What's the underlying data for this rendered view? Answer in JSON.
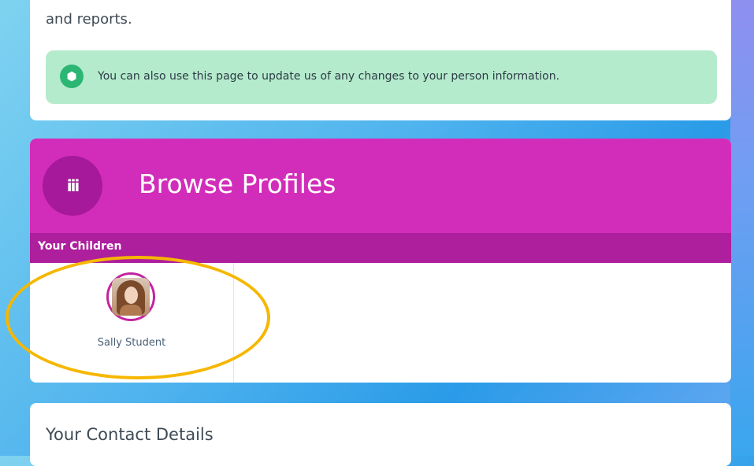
{
  "info_card": {
    "intro_text": "and reports.",
    "notice": {
      "icon": "cube-icon",
      "text": "You can also use this page to update us of any changes to your person information."
    }
  },
  "profiles": {
    "header_icon": "people-group-icon",
    "title": "Browse Profiles",
    "section_label": "Your Children",
    "children": [
      {
        "name": "Sally Student",
        "avatar": "student-photo"
      }
    ]
  },
  "contact": {
    "title": "Your Contact Details"
  },
  "colors": {
    "header_magenta": "#d22dba",
    "subheader_magenta": "#ad1f9c",
    "notice_green": "#b5ebcd",
    "highlight_yellow": "#f6b700"
  }
}
